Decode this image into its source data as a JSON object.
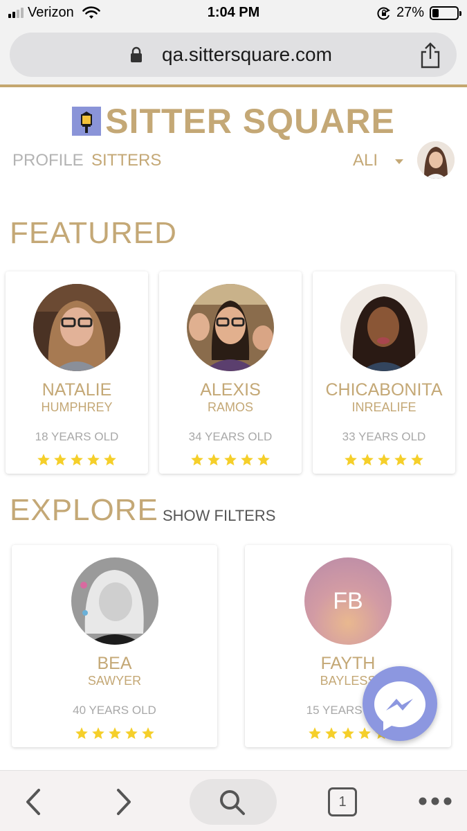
{
  "status_bar": {
    "carrier": "Verizon",
    "time": "1:04 PM",
    "battery_percent_label": "27%",
    "battery_level": 0.27
  },
  "browser": {
    "url": "qa.sittersquare.com"
  },
  "header": {
    "logo_text": "SITTER SQUARE",
    "nav": {
      "profile": "PROFILE",
      "sitters": "SITTERS",
      "user": "ALI"
    }
  },
  "featured": {
    "heading": "FEATURED",
    "cards": [
      {
        "first": "NATALIE",
        "last": "HUMPHREY",
        "age": "18 YEARS OLD",
        "rating": 5
      },
      {
        "first": "ALEXIS",
        "last": "RAMOS",
        "age": "34 YEARS OLD",
        "rating": 5
      },
      {
        "first": "CHICABONITA",
        "last": "INREALIFE",
        "age": "33 YEARS OLD",
        "rating": 5
      }
    ]
  },
  "explore": {
    "heading": "EXPLORE",
    "show_filters": "SHOW FILTERS",
    "cards": [
      {
        "first": "BEA",
        "last": "SAWYER",
        "age": "40 YEARS OLD",
        "rating": 5
      },
      {
        "first": "FAYTH",
        "last": "BAYLESS",
        "age": "15 YEARS OLD",
        "rating": 5,
        "initials": "FB"
      }
    ]
  },
  "toolbar": {
    "tab_count": "1"
  },
  "colors": {
    "brand_gold": "#c4a876",
    "star_yellow": "#f5cf2a",
    "messenger": "#8c97e0"
  },
  "icons": [
    "signal-icon",
    "wifi-icon",
    "rotation-lock-icon",
    "battery-icon",
    "lock-icon",
    "share-icon",
    "lamp-logo-icon",
    "chevron-down-icon",
    "star-icon",
    "messenger-icon",
    "back-icon",
    "forward-icon",
    "search-icon",
    "tabs-icon",
    "more-icon"
  ]
}
